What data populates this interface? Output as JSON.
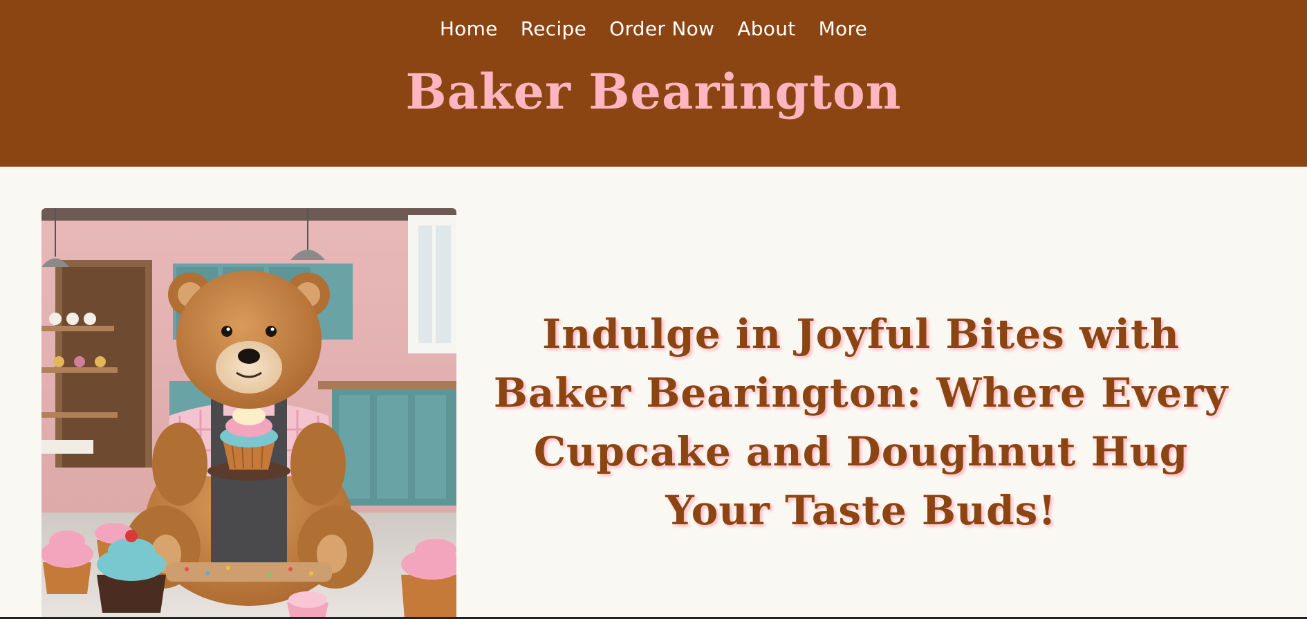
{
  "nav": {
    "items": [
      {
        "label": "Home"
      },
      {
        "label": "Recipe"
      },
      {
        "label": "Order Now"
      },
      {
        "label": "About"
      },
      {
        "label": "More"
      }
    ]
  },
  "brand": {
    "title": "Baker Bearington"
  },
  "hero": {
    "headline": "Indulge in Joyful Bites with Baker Bearington: Where Every Cupcake and Doughnut Hug Your Taste Buds!",
    "image": {
      "icon": "teddy-bear-baker-illustration"
    }
  },
  "colors": {
    "header_bg": "#8b4513",
    "brand_pink": "#ffb6c1",
    "page_bg": "#faf8f3",
    "headline_brown": "#8b4513"
  }
}
